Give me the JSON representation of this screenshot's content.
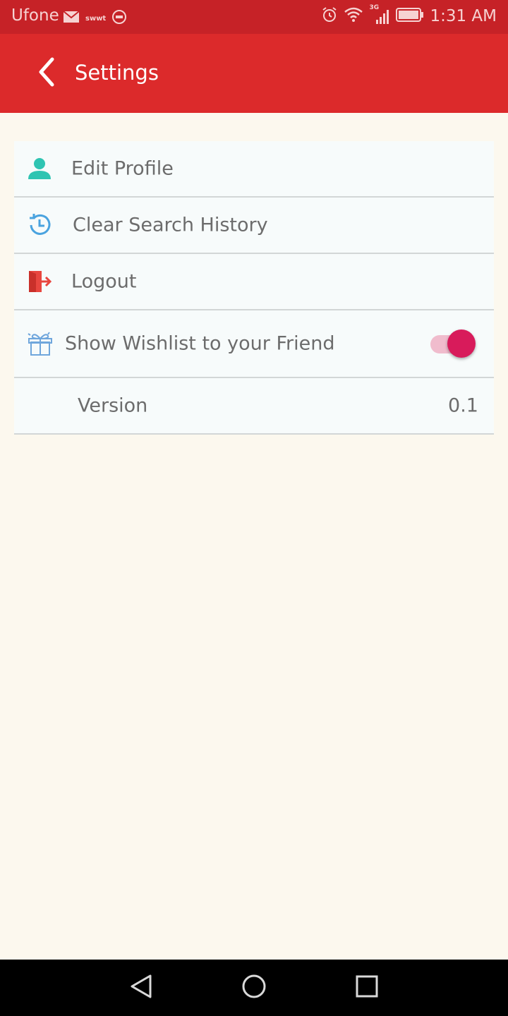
{
  "status_bar": {
    "carrier": "Ufone",
    "small_label": "swwt",
    "network_label": "3G",
    "time": "1:31 AM",
    "icons": [
      "mail-icon",
      "imo-icon",
      "alarm-icon",
      "wifi-icon",
      "signal-icon",
      "battery-icon"
    ]
  },
  "app_bar": {
    "title": "Settings",
    "back_icon": "chevron-left-icon"
  },
  "settings": {
    "items": [
      {
        "label": "Edit Profile",
        "icon": "user-icon",
        "icon_color": "#2fc4b2"
      },
      {
        "label": "Clear Search History",
        "icon": "history-icon",
        "icon_color": "#4aa3df"
      },
      {
        "label": "Logout",
        "icon": "logout-icon",
        "icon_color": "#e8463f"
      },
      {
        "label": "Show Wishlist to your Friend",
        "icon": "gift-icon",
        "icon_color": "#6fa6dc",
        "toggle_on": true
      },
      {
        "label": "Version",
        "value": "0.1"
      }
    ]
  },
  "colors": {
    "status_bar": "#c62227",
    "app_bar": "#dc2a2b",
    "background": "#fcf8ee",
    "card": "#f7fbfb",
    "toggle_thumb": "#d81b5b",
    "toggle_track": "#f0bccd"
  },
  "nav_bar": {
    "buttons": [
      "back-triangle-icon",
      "home-circle-icon",
      "recents-square-icon"
    ]
  }
}
